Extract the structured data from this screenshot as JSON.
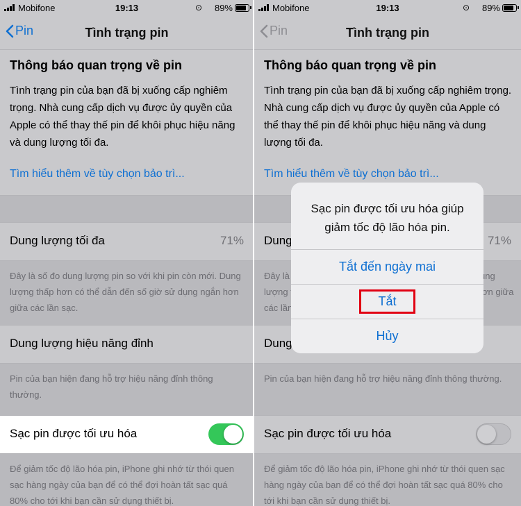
{
  "status_bar": {
    "carrier": "Mobifone",
    "time": "19:13",
    "battery": "89%"
  },
  "nav": {
    "back_label": "Pin",
    "title": "Tình trạng pin"
  },
  "notice": {
    "title": "Thông báo quan trọng về pin",
    "body": "Tình trạng pin của bạn đã bị xuống cấp nghiêm trọng. Nhà cung cấp dịch vụ được ủy quyền của Apple có thể thay thế pin để khôi phục hiệu năng và dung lượng tối đa.",
    "link": "Tìm hiểu thêm về tùy chọn bảo trì..."
  },
  "max_capacity": {
    "label": "Dung lượng tối đa",
    "value": "71%",
    "footnote": "Đây là số đo dung lượng pin so với khi pin còn mới. Dung lượng thấp hơn có thể dẫn đến số giờ sử dụng ngắn hơn giữa các lần sạc."
  },
  "peak_performance": {
    "label": "Dung lượng hiệu năng đỉnh",
    "footnote": "Pin của bạn hiện đang hỗ trợ hiệu năng đỉnh thông thường."
  },
  "optimized_charging": {
    "label": "Sạc pin được tối ưu hóa",
    "footnote": "Để giảm tốc độ lão hóa pin, iPhone ghi nhớ từ thói quen sạc hàng ngày của bạn để có thể đợi hoàn tất sạc quá 80% cho tới khi bạn cần sử dụng thiết bị."
  },
  "left": {
    "toggle_on": true,
    "label_cut": "Dung"
  },
  "right": {
    "toggle_on": false,
    "max_label_partial": "Dung",
    "peak_label_partial": "Dung"
  },
  "alert": {
    "message": "Sạc pin được tối ưu hóa giúp giảm tốc độ lão hóa pin.",
    "buttons": [
      "Tắt đến ngày mai",
      "Tắt",
      "Hủy"
    ]
  },
  "colors": {
    "accent": "#0d6fd2",
    "toggle_on": "#34c759",
    "highlight_box": "#e10012"
  }
}
